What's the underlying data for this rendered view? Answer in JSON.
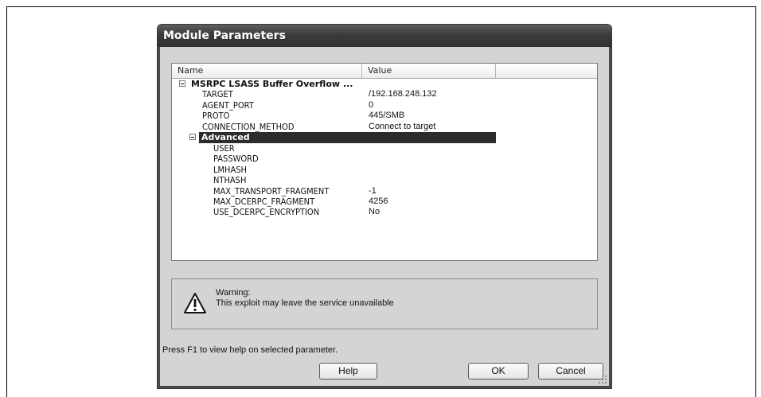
{
  "window": {
    "title": "Module Parameters"
  },
  "listview": {
    "columns": {
      "name": "Name",
      "value": "Value"
    },
    "module": {
      "name": "MSRPC LSASS Buffer Overflow ..."
    },
    "params": [
      {
        "name": "TARGET",
        "value": "/192.168.248.132"
      },
      {
        "name": "AGENT_PORT",
        "value": "0"
      },
      {
        "name": "PROTO",
        "value": "445/SMB"
      },
      {
        "name": "CONNECTION_METHOD",
        "value": "Connect to target"
      }
    ],
    "advanced": {
      "label": "Advanced",
      "params": [
        {
          "name": "USER",
          "value": ""
        },
        {
          "name": "PASSWORD",
          "value": ""
        },
        {
          "name": "LMHASH",
          "value": ""
        },
        {
          "name": "NTHASH",
          "value": ""
        },
        {
          "name": "MAX_TRANSPORT_FRAGMENT",
          "value": "-1"
        },
        {
          "name": "MAX_DCERPC_FRAGMENT",
          "value": "4256"
        },
        {
          "name": "USE_DCERPC_ENCRYPTION",
          "value": "No"
        }
      ]
    }
  },
  "warning": {
    "label": "Warning:",
    "text": "This exploit may leave the service unavailable",
    "icon": "warning-triangle-icon"
  },
  "hint": "Press F1 to view help on selected parameter.",
  "buttons": {
    "help": "Help",
    "ok": "OK",
    "cancel": "Cancel"
  }
}
